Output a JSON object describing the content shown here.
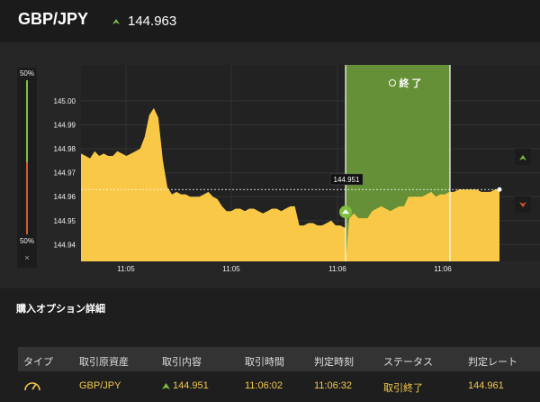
{
  "header": {
    "pair": "GBP/JPY",
    "rate": "144.963"
  },
  "gauge": {
    "top_label": "50%",
    "bottom_label": "50%",
    "close": "×"
  },
  "chart_data": {
    "type": "area",
    "y_ticks": [
      "145.00",
      "144.99",
      "144.98",
      "144.97",
      "144.96",
      "144.95",
      "144.94"
    ],
    "x_ticks": [
      "11:05",
      "11:05",
      "11:06",
      "11:06"
    ],
    "ylim": [
      144.933,
      145.015
    ],
    "series": [
      {
        "values": [
          144.978,
          144.977,
          144.976,
          144.979,
          144.977,
          144.978,
          144.977,
          144.977,
          144.979,
          144.978,
          144.977,
          144.978,
          144.979,
          144.98,
          144.985,
          144.994,
          144.997,
          144.993,
          144.975,
          144.964,
          144.961,
          144.962,
          144.961,
          144.961,
          144.96,
          144.96,
          144.96,
          144.961,
          144.962,
          144.96,
          144.959,
          144.956,
          144.954,
          144.954,
          144.955,
          144.955,
          144.954,
          144.955,
          144.955,
          144.954,
          144.953,
          144.954,
          144.955,
          144.955,
          144.954,
          144.955,
          144.956,
          144.956,
          144.948,
          144.948,
          144.949,
          144.949,
          144.948,
          144.948,
          144.949,
          144.95,
          144.948,
          144.948,
          144.947,
          144.951,
          144.953,
          144.951,
          144.951,
          144.951,
          144.954,
          144.955,
          144.956,
          144.955,
          144.954,
          144.955,
          144.956,
          144.956,
          144.96,
          144.96,
          144.96,
          144.96,
          144.961,
          144.962,
          144.96,
          144.961,
          144.961,
          144.962,
          144.962,
          144.963,
          144.963,
          144.963,
          144.963,
          144.963,
          144.962,
          144.962,
          144.962,
          144.963,
          144.963
        ]
      }
    ],
    "current_rate_label": "144.951",
    "window_label": "終 了"
  },
  "colors": {
    "area": "#f9c846",
    "window": "#6e9c3a",
    "up": "#7fbf3f",
    "down": "#d9582b"
  },
  "section_title": "購入オプション詳細",
  "table": {
    "headers": [
      "タイプ",
      "取引原資産",
      "取引内容",
      "取引時間",
      "判定時刻",
      "ステータス",
      "判定レート"
    ],
    "row": {
      "asset": "GBP/JPY",
      "content": "144.951",
      "trade_time": "11:06:02",
      "judge_time": "11:06:32",
      "status": "取引終了",
      "rate": "144.961"
    }
  }
}
